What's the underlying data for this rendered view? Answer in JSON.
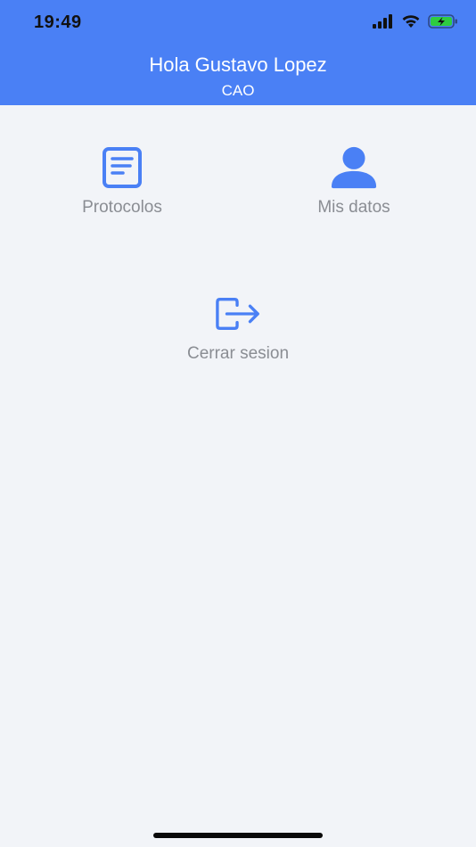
{
  "status_bar": {
    "time": "19:49",
    "icons": [
      "cellular-signal-icon",
      "wifi-icon",
      "battery-charging-icon"
    ]
  },
  "header": {
    "greeting": "Hola Gustavo Lopez",
    "subtitle": "CAO"
  },
  "menu": {
    "items": [
      {
        "label": "Protocolos",
        "icon": "document-icon"
      },
      {
        "label": "Mis datos",
        "icon": "user-icon"
      },
      {
        "label": "Cerrar sesion",
        "icon": "logout-icon"
      }
    ]
  },
  "colors": {
    "accent": "#4a80f5",
    "background": "#f2f4f8",
    "label": "#8a8d93",
    "battery": "#2ecc40"
  }
}
